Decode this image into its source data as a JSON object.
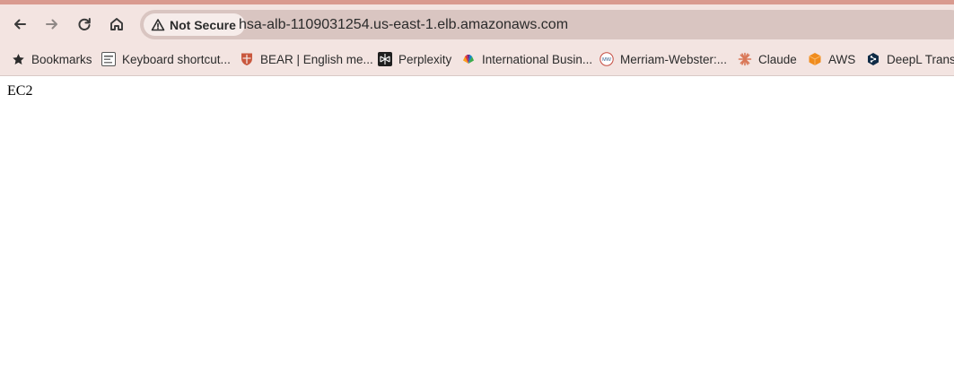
{
  "browser": {
    "nav": {
      "back_icon": "arrow-left-icon",
      "forward_icon": "arrow-right-icon",
      "reload_icon": "reload-icon",
      "home_icon": "home-icon"
    },
    "security_chip": {
      "icon": "warning-triangle-icon",
      "label": "Not Secure"
    },
    "url": "hsa-alb-1109031254.us-east-1.elb.amazonaws.com",
    "colors": {
      "accent_strip": "#d99a8f",
      "toolbar_bg": "#f3e4e1",
      "omnibox_bg": "#d9c5c1"
    }
  },
  "bookmarks": [
    {
      "label": "Bookmarks",
      "icon": "star-icon"
    },
    {
      "label": "Keyboard shortcut...",
      "icon": "keyboard-favicon"
    },
    {
      "label": "BEAR | English me...",
      "icon": "shield-crest-favicon"
    },
    {
      "label": "Perplexity",
      "icon": "perplexity-favicon"
    },
    {
      "label": "International Busin...",
      "icon": "nbc-peacock-favicon"
    },
    {
      "label": "Merriam-Webster:...",
      "icon": "merriam-webster-favicon"
    },
    {
      "label": "Claude",
      "icon": "claude-favicon"
    },
    {
      "label": "AWS",
      "icon": "aws-cube-favicon"
    },
    {
      "label": "DeepL Transl",
      "icon": "deepl-favicon"
    }
  ],
  "page": {
    "content": "EC2"
  }
}
